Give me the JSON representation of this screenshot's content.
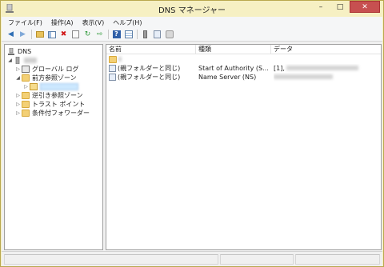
{
  "window": {
    "title": "DNS マネージャー"
  },
  "menu": [
    "ファイル(F)",
    "操作(A)",
    "表示(V)",
    "ヘルプ(H)"
  ],
  "toolbar": {
    "icons": [
      "back-icon",
      "forward-icon",
      "up-folder-icon",
      "show-hide-tree-icon",
      "delete-icon",
      "properties-icon",
      "refresh-icon",
      "export-list-icon",
      "help-icon",
      "details-view-icon",
      "server-icon",
      "record-icon",
      "zone-icon"
    ]
  },
  "tree": {
    "root": "DNS",
    "server": "",
    "items": {
      "global_log": "グローバル ログ",
      "forward_zones": "前方参照ゾーン",
      "zone_selected": "",
      "reverse_zones": "逆引き参照ゾーン",
      "trust_points": "トラスト ポイント",
      "conditional_forwarders": "条件付フォワーダー"
    }
  },
  "list": {
    "columns": {
      "name": "名前",
      "type": "種類",
      "data": "データ"
    },
    "rows": [
      {
        "name": "",
        "type": "",
        "data": ""
      },
      {
        "name": "(親フォルダーと同じ)",
        "type": "Start of Authority (S...",
        "data": "[1],"
      },
      {
        "name": "(親フォルダーと同じ)",
        "type": "Name Server (NS)",
        "data": ""
      }
    ]
  }
}
